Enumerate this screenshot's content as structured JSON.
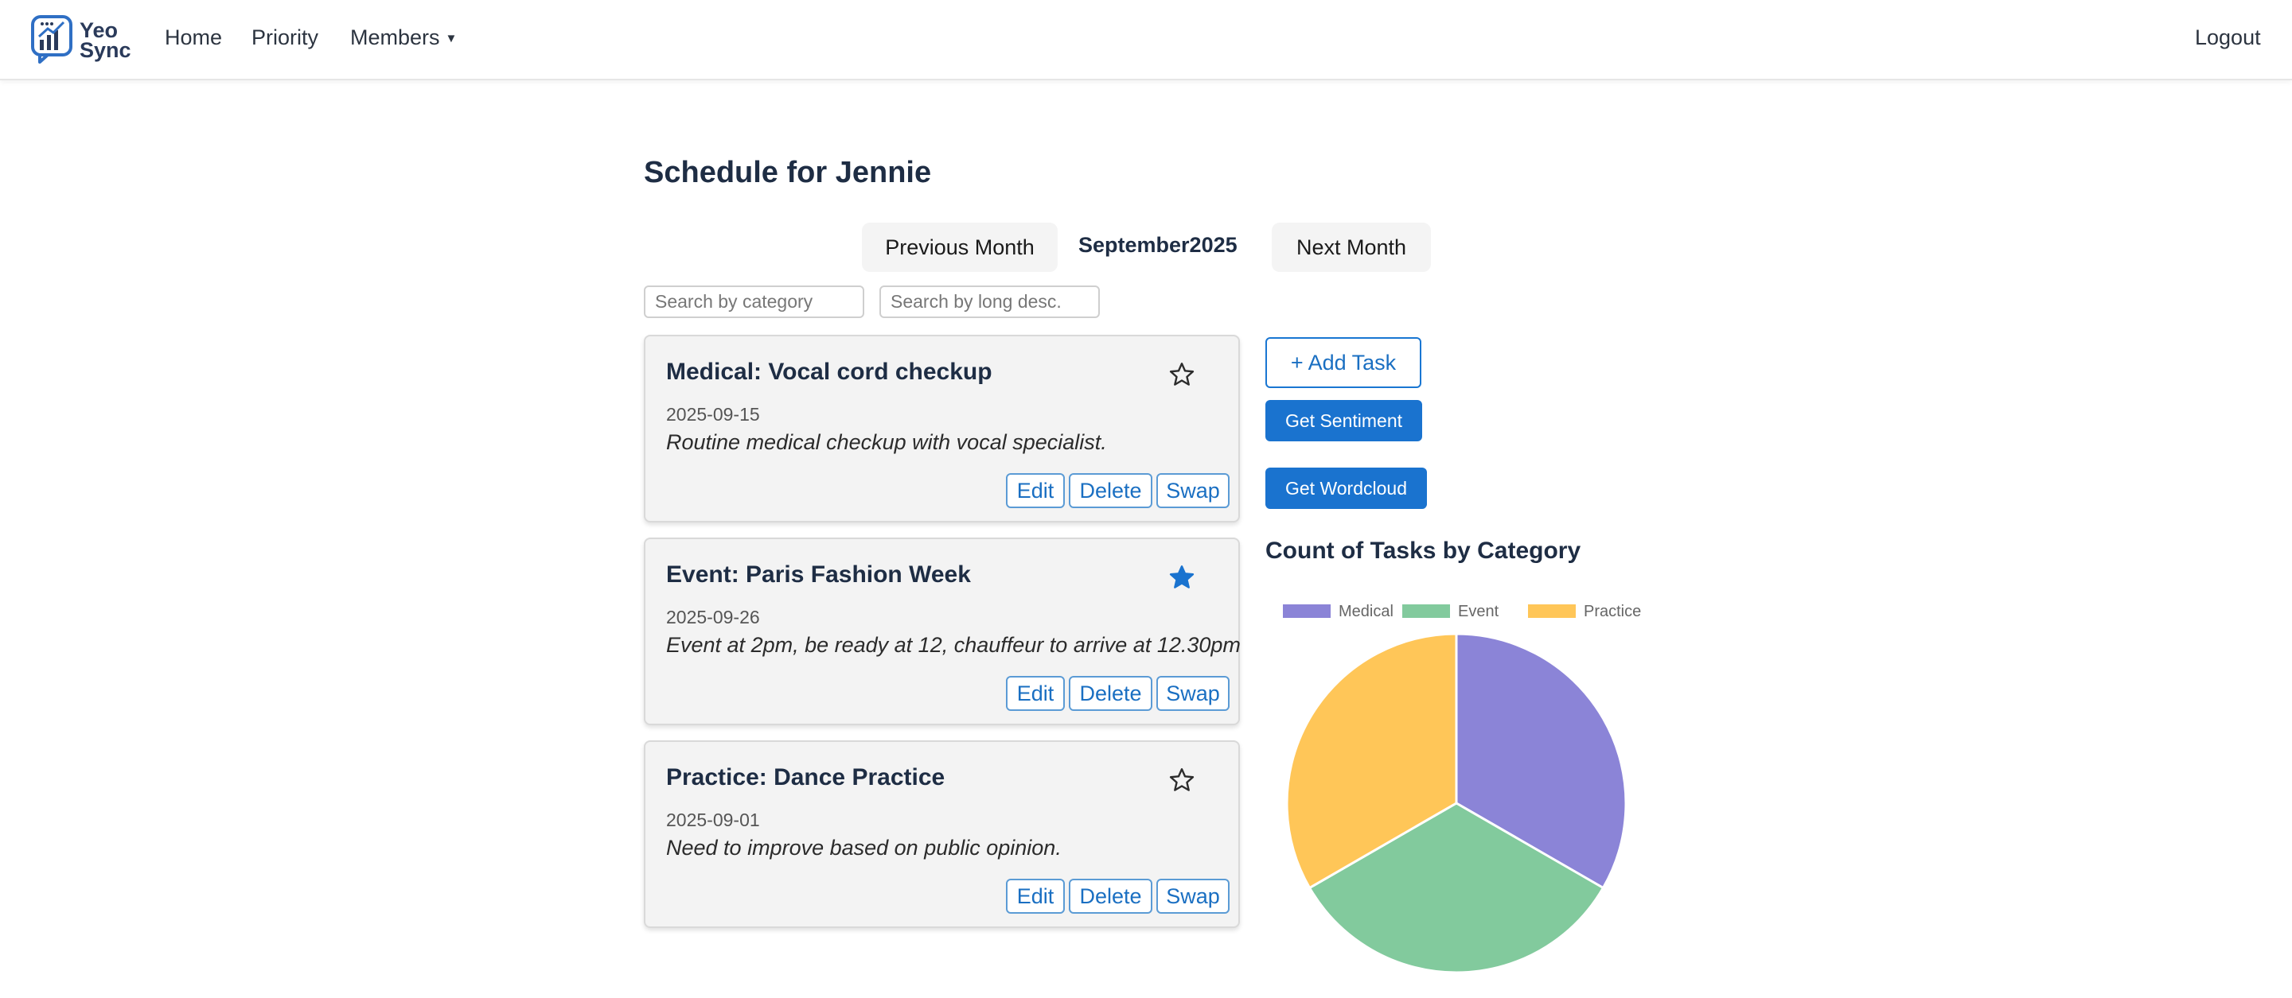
{
  "app": {
    "logo_line1": "Yeo",
    "logo_line2": "Sync"
  },
  "nav": {
    "home": "Home",
    "priority": "Priority",
    "members": "Members",
    "logout": "Logout"
  },
  "page": {
    "title": "Schedule for Jennie",
    "prev_month": "Previous Month",
    "month_label": "September2025",
    "next_month": "Next Month"
  },
  "search": {
    "category_placeholder": "Search by category",
    "desc_placeholder": "Search by long desc."
  },
  "tasks": [
    {
      "title": "Medical: Vocal cord checkup",
      "date": "2025-09-15",
      "desc": "Routine medical checkup with vocal specialist.",
      "starred": false
    },
    {
      "title": "Event: Paris Fashion Week",
      "date": "2025-09-26",
      "desc": "Event at 2pm, be ready at 12, chauffeur to arrive at 12.30pm",
      "starred": true
    },
    {
      "title": "Practice: Dance Practice",
      "date": "2025-09-01",
      "desc": "Need to improve based on public opinion.",
      "starred": false
    }
  ],
  "card_actions": {
    "edit": "Edit",
    "delete": "Delete",
    "swap": "Swap"
  },
  "side_actions": {
    "add_task": "+ Add Task",
    "get_sentiment": "Get Sentiment",
    "get_wordcloud": "Get Wordcloud"
  },
  "icons": {
    "star_empty": "star-outline-icon",
    "star_filled": "star-filled-icon",
    "caret": "caret-down-icon"
  },
  "colors": {
    "accent": "#1a73cf",
    "star_filled": "#1a73cf"
  },
  "chart_data": {
    "type": "pie",
    "title": "Count of Tasks by Category",
    "categories": [
      "Medical",
      "Event",
      "Practice"
    ],
    "values": [
      1,
      1,
      1
    ],
    "colors": [
      "#8b84d7",
      "#82ca9d",
      "#ffc658"
    ],
    "legend": "top"
  }
}
